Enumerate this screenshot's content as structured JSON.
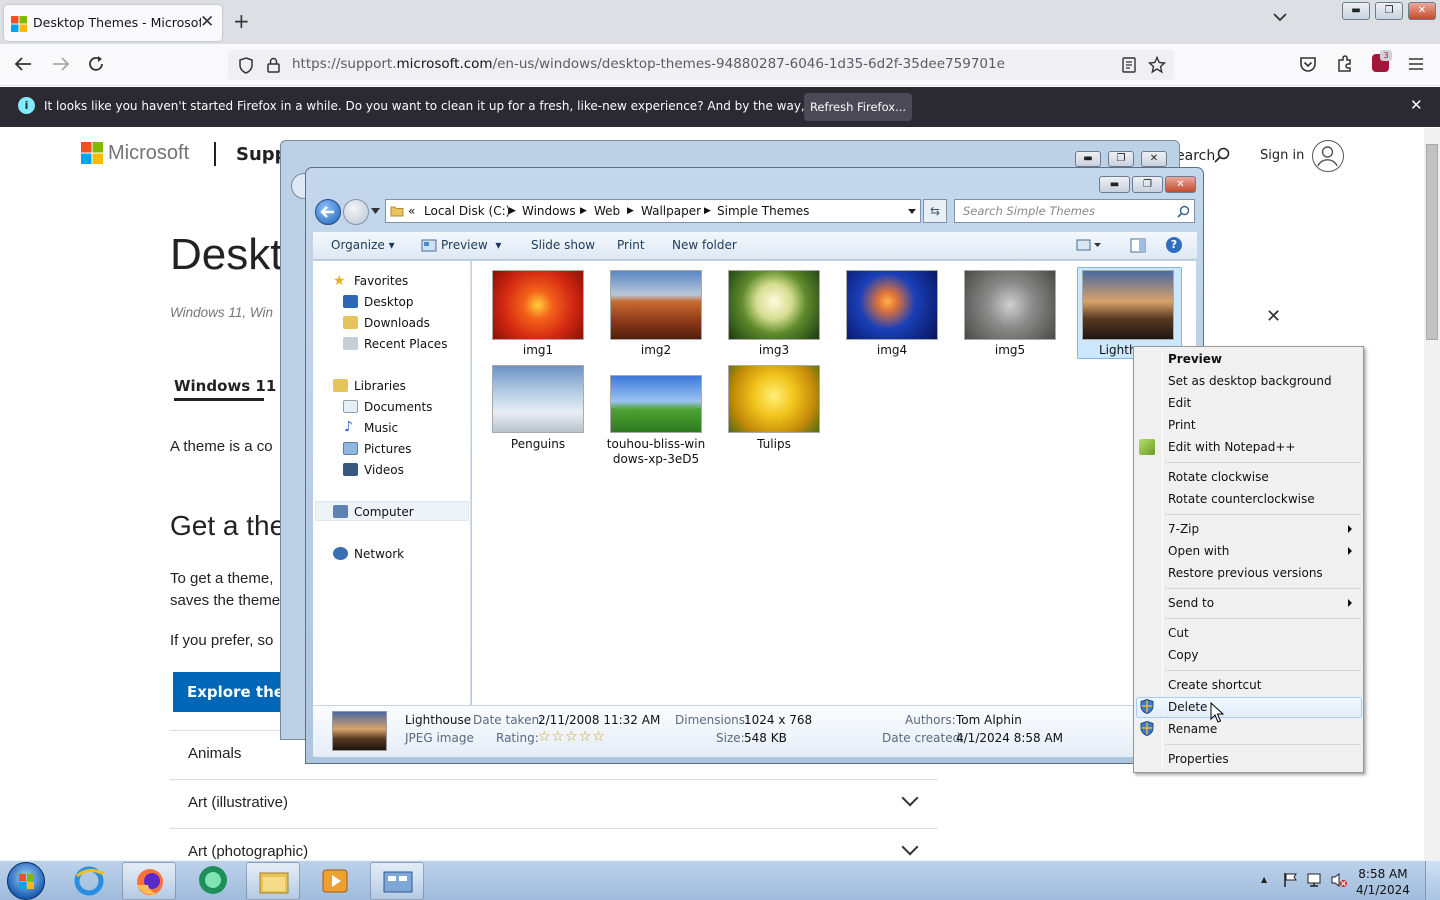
{
  "browser": {
    "tab_title": "Desktop Themes - Microsoft Su",
    "tab_close": "✕",
    "new_tab": "+",
    "url_prefix": "https://support.",
    "url_domain": "microsoft.com",
    "url_path": "/en-us/windows/desktop-themes-94880287-6046-1d35-6d2f-35dee759701e",
    "extension_badge": "3",
    "notification": {
      "text": "It looks like you haven't started Firefox in a while. Do you want to clean it up for a fresh, like-new experience? And by the way, welcome back!",
      "button": "Refresh Firefox...",
      "close": "✕"
    }
  },
  "webpage": {
    "brand": "Microsoft",
    "section": "Supp",
    "search_label": "earch",
    "signin": "Sign in",
    "title": "Deskt",
    "applies_to": "Windows 11, Win",
    "tab_label": "Windows 11",
    "para1": "A theme is a co",
    "heading2": "Get a the",
    "para2_line1": "To get a theme,",
    "para2_line2": "saves the theme",
    "para3": "If you prefer, so",
    "explore_button": "Explore them",
    "accordion": [
      "Animals",
      "Art (illustrative)",
      "Art (photographic)"
    ],
    "close": "✕"
  },
  "explorer": {
    "breadcrumb": [
      "Local Disk (C:)",
      "Windows",
      "Web",
      "Wallpaper",
      "Simple Themes"
    ],
    "breadcrumb_lead": "«",
    "search_placeholder": "Search Simple Themes",
    "toolbar": {
      "organize": "Organize",
      "preview": "Preview",
      "slideshow": "Slide show",
      "print": "Print",
      "new_folder": "New folder"
    },
    "nav": {
      "favorites": "Favorites",
      "desktop": "Desktop",
      "downloads": "Downloads",
      "recent": "Recent Places",
      "libraries": "Libraries",
      "documents": "Documents",
      "music": "Music",
      "pictures": "Pictures",
      "videos": "Videos",
      "computer": "Computer",
      "network": "Network"
    },
    "files": [
      {
        "name": "img1"
      },
      {
        "name": "img2"
      },
      {
        "name": "img3"
      },
      {
        "name": "img4"
      },
      {
        "name": "img5"
      },
      {
        "name": "Lighth"
      },
      {
        "name": "Penguins"
      },
      {
        "name": "touhou-bliss-win",
        "name2": "dows-xp-3eD5"
      },
      {
        "name": "Tulips"
      }
    ],
    "details": {
      "name": "Lighthouse",
      "type": "JPEG image",
      "date_taken_label": "Date taken:",
      "date_taken": "2/11/2008 11:32 AM",
      "rating_label": "Rating:",
      "rating": "☆☆☆☆☆",
      "dimensions_label": "Dimensions:",
      "dimensions": "1024 x 768",
      "size_label": "Size:",
      "size": "548 KB",
      "authors_label": "Authors:",
      "authors": "Tom Alphin",
      "created_label": "Date created:",
      "created": "4/1/2024 8:58 AM"
    }
  },
  "context_menu": {
    "items": [
      "Preview",
      "Set as desktop background",
      "Edit",
      "Print",
      "Edit with Notepad++",
      "Rotate clockwise",
      "Rotate counterclockwise",
      "7-Zip",
      "Open with",
      "Restore previous versions",
      "Send to",
      "Cut",
      "Copy",
      "Create shortcut",
      "Delete",
      "Rename",
      "Properties"
    ]
  },
  "taskbar": {
    "time": "8:58 AM",
    "date": "4/1/2024",
    "tray_arrow": "▲"
  }
}
